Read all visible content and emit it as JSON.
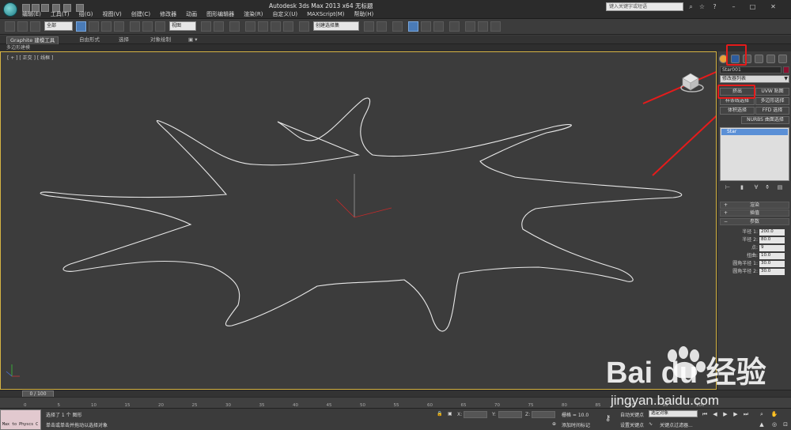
{
  "titlebar": {
    "title": "Autodesk 3ds Max  2013 x64     无标题",
    "search_placeholder": "键入关键字或短语",
    "menu": [
      "编辑(E)",
      "工具(T)",
      "组(G)",
      "视图(V)",
      "创建(C)",
      "修改器",
      "动画",
      "图形编辑器",
      "渲染(R)",
      "自定义(U)",
      "MAXScript(M)",
      "帮助(H)"
    ]
  },
  "toolbar": {
    "filter_value": "全部",
    "refcoord_value": "视图",
    "selection_set_placeholder": "创建选择集"
  },
  "ribbon": {
    "tabs": [
      "Graphite 建模工具",
      "自由形式",
      "选择",
      "对象绘制"
    ],
    "sub_label": "多边形建模"
  },
  "viewport": {
    "label": "[ + ] [ 正交 ] [ 线框 ]"
  },
  "command_panel": {
    "object_name": "Star001",
    "modifier_list": "修改器列表",
    "modifier_buttons": [
      "挤出",
      "UVW 贴图",
      "样条线选择",
      "多边形选择",
      "体积选择",
      "FFD 选择",
      "NURBS 曲面选择"
    ],
    "stack_item": "Star",
    "rollouts": {
      "render": "渲染",
      "interp": "插值",
      "params": "参数"
    },
    "params": [
      {
        "label": "半径 1:",
        "value": "200.0"
      },
      {
        "label": "半径 2:",
        "value": "80.0"
      },
      {
        "label": "点:",
        "value": "9"
      },
      {
        "label": "扭曲:",
        "value": "10.0"
      },
      {
        "label": "圆角半径 1:",
        "value": "30.0"
      },
      {
        "label": "圆角半径 2:",
        "value": "30.0"
      }
    ]
  },
  "timeline": {
    "frame_readout": "0 / 100",
    "ticks": [
      "0",
      "5",
      "10",
      "15",
      "20",
      "25",
      "30",
      "35",
      "40",
      "45",
      "50",
      "55",
      "60",
      "65",
      "70",
      "75",
      "80",
      "85",
      "90",
      "95",
      "100"
    ]
  },
  "statusbar": {
    "maxscript": "Max to Physcs C",
    "selection_status": "选择了 1 个 图形",
    "prompt": "单击或单击并拖动以选择对象",
    "x_label": "X:",
    "y_label": "Y:",
    "z_label": "Z:",
    "grid": "栅格 = 10.0",
    "add_time_tag": "添加时间标记",
    "auto_key": "自动关键点",
    "set_key": "设置关键点",
    "selected_dropdown": "选定对象",
    "key_filters": "关键点过滤器..."
  },
  "watermark": {
    "logo": "Bai du 经验",
    "url": "jingyan.baidu.com"
  },
  "colors": {
    "accent_blue": "#4a7bb7",
    "annotation_red": "#e51b1b",
    "viewport_border": "#d6b443",
    "object_color": "#8b1030"
  },
  "icons": [
    "app-logo-icon",
    "select-icon",
    "move-icon",
    "rotate-icon",
    "scale-icon",
    "snap-icon",
    "render-icon",
    "create-icon",
    "modify-icon",
    "hierarchy-icon",
    "motion-icon",
    "display-icon",
    "utilities-icon",
    "play-icon"
  ]
}
